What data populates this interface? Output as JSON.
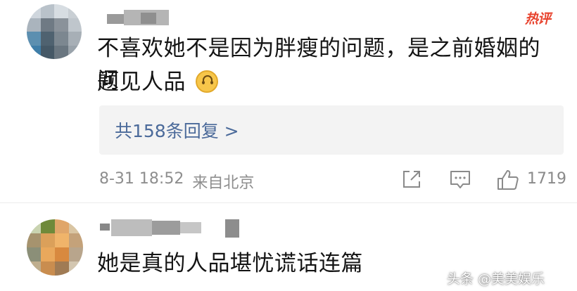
{
  "comments": [
    {
      "badge": "热评",
      "text_line1": "不喜欢她不是因为胖瘦的问题，是之前婚姻的问",
      "text_line2": "题见人品",
      "replies_label": "共158条回复 >",
      "time": "8-31 18:52",
      "location": "来自北京",
      "like_count": "1719",
      "icons": [
        "share-icon",
        "comment-icon",
        "like-icon"
      ]
    },
    {
      "text_line1": "她是真的人品堪忧谎话连篇"
    }
  ],
  "watermark": {
    "text": "头条 @美美娱乐"
  },
  "colors": {
    "hot_badge": "#e8432e",
    "reply_link": "#4b6a9a",
    "meta_gray": "#8e8e8e"
  }
}
